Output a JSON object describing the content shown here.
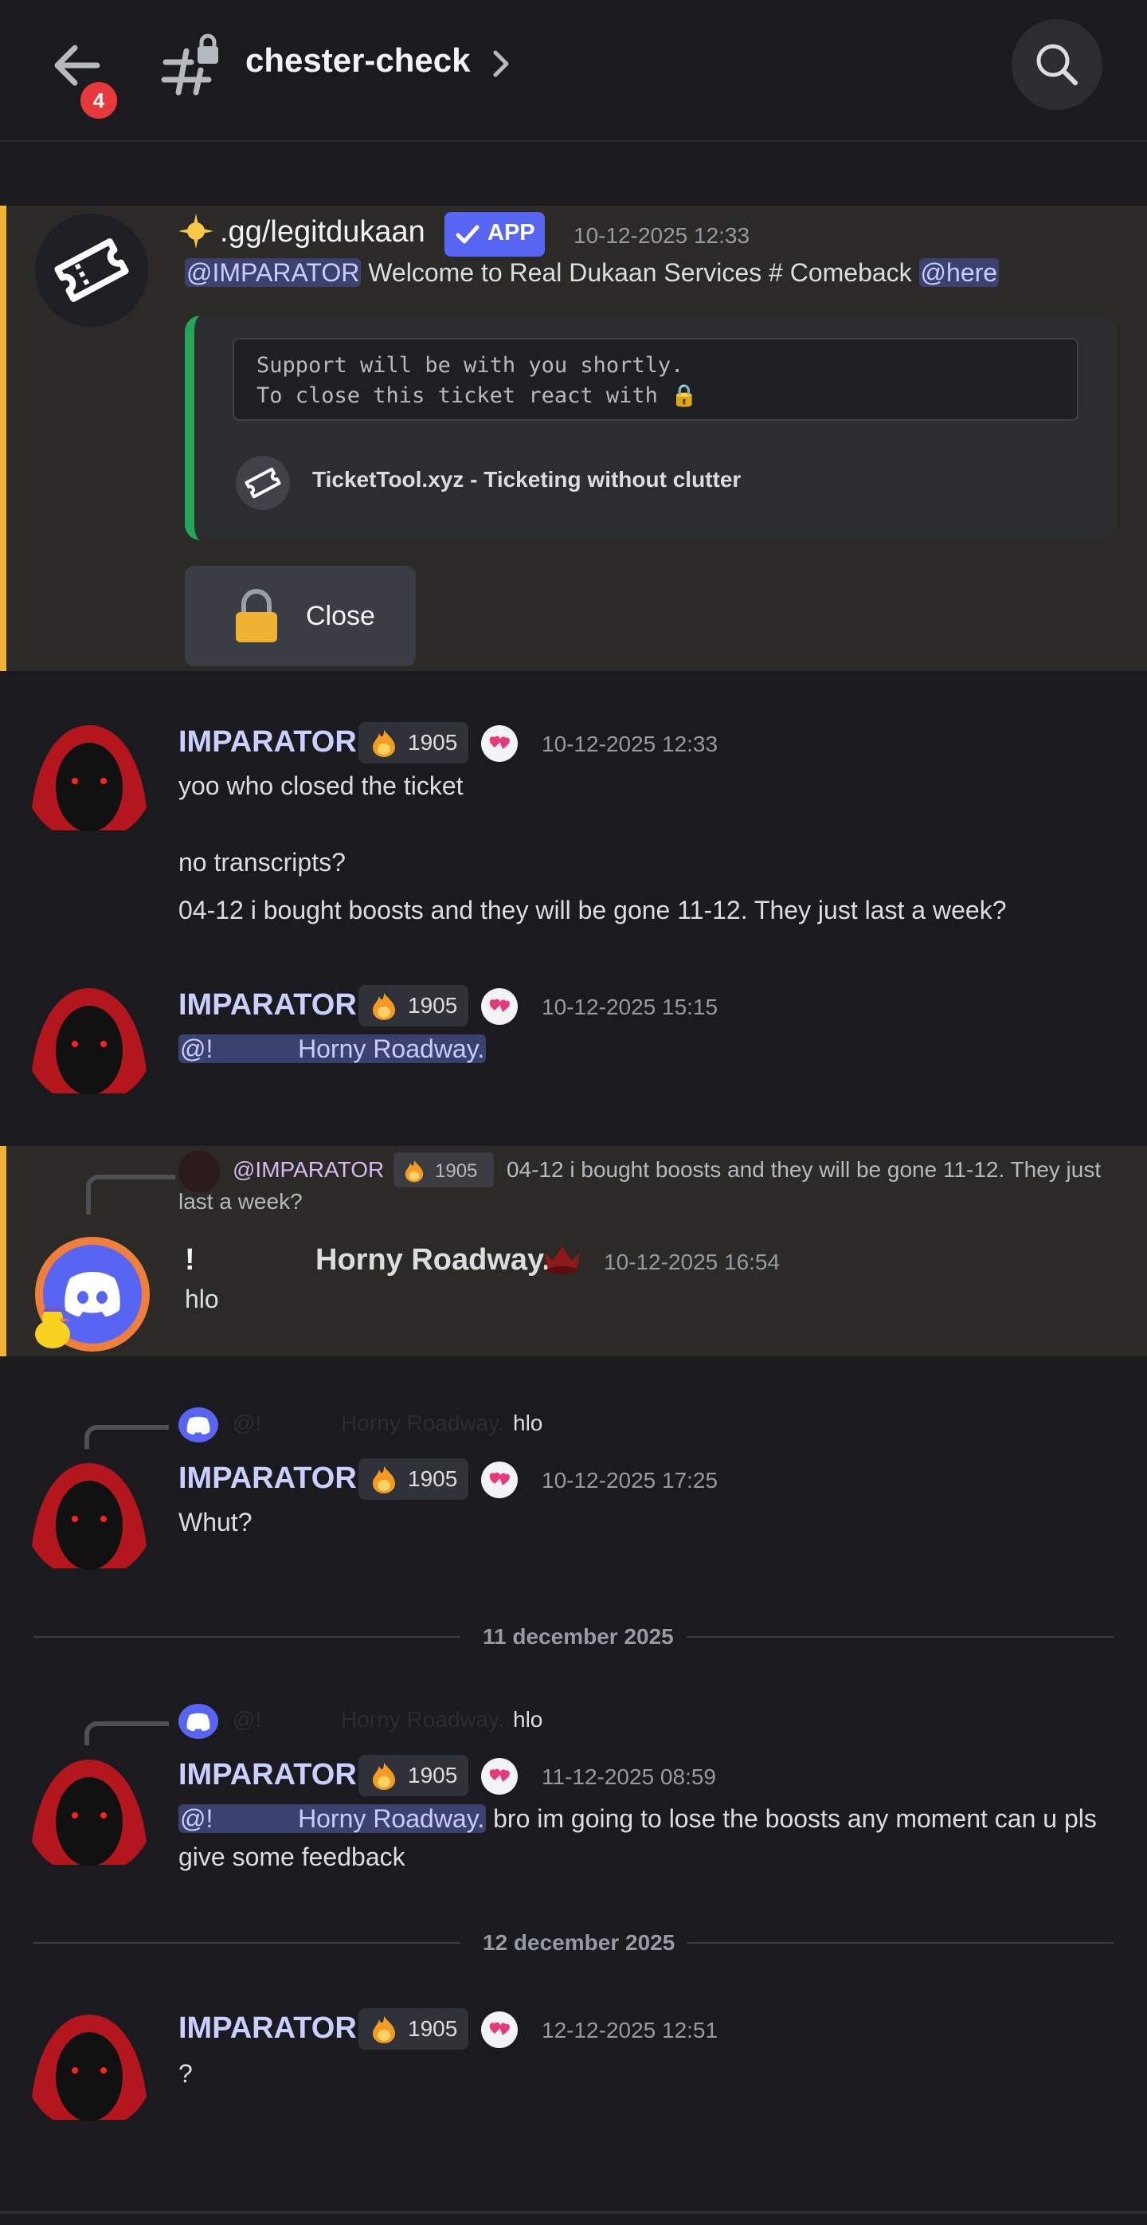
{
  "header": {
    "channel_name": "chester-check",
    "badge_count": "4"
  },
  "bot_message": {
    "name": ".gg/legitdukaan",
    "app_badge": "APP",
    "timestamp": "10-12-2025 12:33",
    "mention_user": "@IMPARATOR",
    "text": "Welcome to Real Dukaan Services # Comeback",
    "mention_here": "@here",
    "embed_line1": "Support will be with you shortly.",
    "embed_line2": "To close this ticket react with 🔒",
    "embed_footer": "TicketTool.xyz - Ticketing without clutter",
    "close_button": "Close"
  },
  "msg1": {
    "name": "IMPARATOR",
    "tag": "1905",
    "timestamp": "10-12-2025 12:33",
    "line1": "yoo who closed the ticket",
    "line2": "no transcripts?",
    "line3": "04-12 i bought boosts and they will be gone 11-12. They just last a week?"
  },
  "msg2": {
    "name": "IMPARATOR",
    "tag": "1905",
    "timestamp": "10-12-2025 15:15",
    "mention": "@!            Horny Roadway."
  },
  "msg3": {
    "reply_name": "@IMPARATOR",
    "reply_tag": "1905",
    "reply_text_1": "04-12 i bought boosts and they will be gone 11-12. They just",
    "reply_text_2": "last a week?",
    "name_prefix": "!",
    "name": "Horny Roadway.",
    "timestamp": "10-12-2025 16:54",
    "text": "hlo"
  },
  "msg4": {
    "reply_prefix": "@!",
    "reply_name": "Horny Roadway.",
    "reply_text": "hlo",
    "name": "IMPARATOR",
    "tag": "1905",
    "timestamp": "10-12-2025 17:25",
    "text": "Whut?"
  },
  "divider1": "11 december 2025",
  "msg5": {
    "reply_prefix": "@!",
    "reply_name": "Horny Roadway.",
    "reply_text": "hlo",
    "name": "IMPARATOR",
    "tag": "1905",
    "timestamp": "11-12-2025 08:59",
    "mention": "@!            Horny Roadway.",
    "text_1": " bro im going to lose the boosts any moment can u pls",
    "text_2": "give some feedback"
  },
  "divider2": "12 december 2025",
  "msg6": {
    "name": "IMPARATOR",
    "tag": "1905",
    "timestamp": "12-12-2025 12:51",
    "text": "?"
  },
  "colors": {
    "background": "#1b1b1f",
    "highlight": "#2c2a26",
    "highlight_bar": "#f0b232",
    "app_badge": "#5865f2",
    "embed_bar": "#23a55a",
    "badge_red": "#e5393b"
  }
}
